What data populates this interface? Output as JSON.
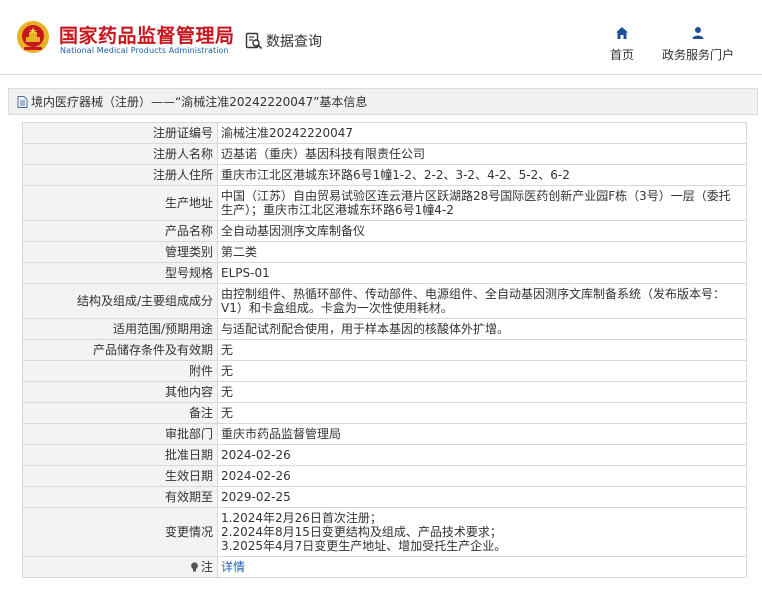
{
  "header": {
    "logo_cn": "国家药品监督管理局",
    "logo_en": "National Medical Products Administration",
    "search_label": "数据查询",
    "nav": [
      {
        "label": "首页",
        "icon": "home-icon"
      },
      {
        "label": "政务服务门户",
        "icon": "user-icon"
      }
    ]
  },
  "titlebar": {
    "text": "境内医疗器械（注册）——“渝械注准20242220047”基本信息"
  },
  "rows": [
    {
      "label": "注册证编号",
      "value": "渝械注准20242220047"
    },
    {
      "label": "注册人名称",
      "value": "迈基诺（重庆）基因科技有限责任公司"
    },
    {
      "label": "注册人住所",
      "value": "重庆市江北区港城东环路6号1幢1-2、2-2、3-2、4-2、5-2、6-2"
    },
    {
      "label": "生产地址",
      "value": "中国（江苏）自由贸易试验区连云港片区跃湖路28号国际医药创新产业园F栋（3号）一层（委托生产）；重庆市江北区港城东环路6号1幢4-2"
    },
    {
      "label": "产品名称",
      "value": "全自动基因测序文库制备仪"
    },
    {
      "label": "管理类别",
      "value": "第二类"
    },
    {
      "label": "型号规格",
      "value": "ELPS-01"
    },
    {
      "label": "结构及组成/主要组成成分",
      "value": "由控制组件、热循环部件、传动部件、电源组件、全自动基因测序文库制备系统（发布版本号：V1）和卡盒组成。卡盒为一次性使用耗材。"
    },
    {
      "label": "适用范围/预期用途",
      "value": "与适配试剂配合使用，用于样本基因的核酸体外扩增。"
    },
    {
      "label": "产品储存条件及有效期",
      "value": "无"
    },
    {
      "label": "附件",
      "value": "无"
    },
    {
      "label": "其他内容",
      "value": "无"
    },
    {
      "label": "备注",
      "value": "无"
    },
    {
      "label": "审批部门",
      "value": "重庆市药品监督管理局"
    },
    {
      "label": "批准日期",
      "value": "2024-02-26"
    },
    {
      "label": "生效日期",
      "value": "2024-02-26"
    },
    {
      "label": "有效期至",
      "value": "2029-02-25"
    }
  ],
  "changes": {
    "label": "变更情况",
    "lines": [
      "1.2024年2月26日首次注册；",
      "2.2024年8月15日变更结构及组成、产品技术要求；",
      "3.2025年4月7日变更生产地址、增加受托生产企业。"
    ]
  },
  "note": {
    "label": "注",
    "link": "详情"
  },
  "colors": {
    "brand_red": "#c8161e",
    "brand_blue": "#1f5fa3",
    "link_blue": "#2a62b8",
    "label_bg": "#f3f3f3"
  }
}
